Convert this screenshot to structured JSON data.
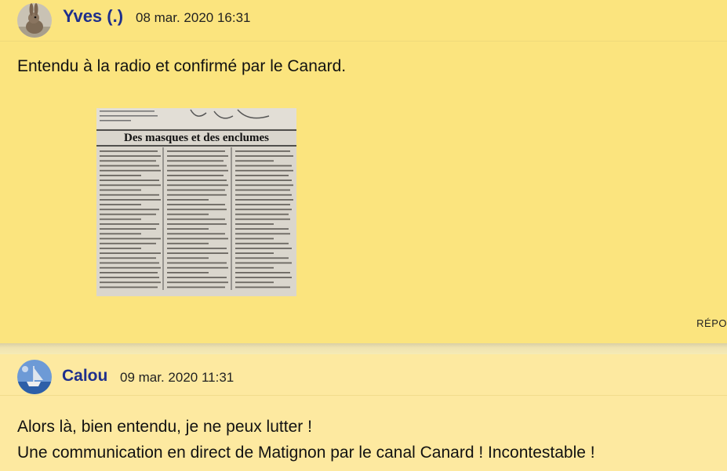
{
  "comments": [
    {
      "author": "Yves (.)",
      "date": "08 mar. 2020 16:31",
      "text": "Entendu à la radio et confirmé par le Canard.",
      "image_headline": "Des masques et des enclumes",
      "reply_label": "RÉPO"
    },
    {
      "author": "Calou",
      "date": "09 mar. 2020 11:31",
      "lines": [
        "Alors là, bien entendu, je ne peux lutter !",
        "Une communication en direct de Matignon par le canal Canard ! Incontestable !"
      ]
    }
  ]
}
